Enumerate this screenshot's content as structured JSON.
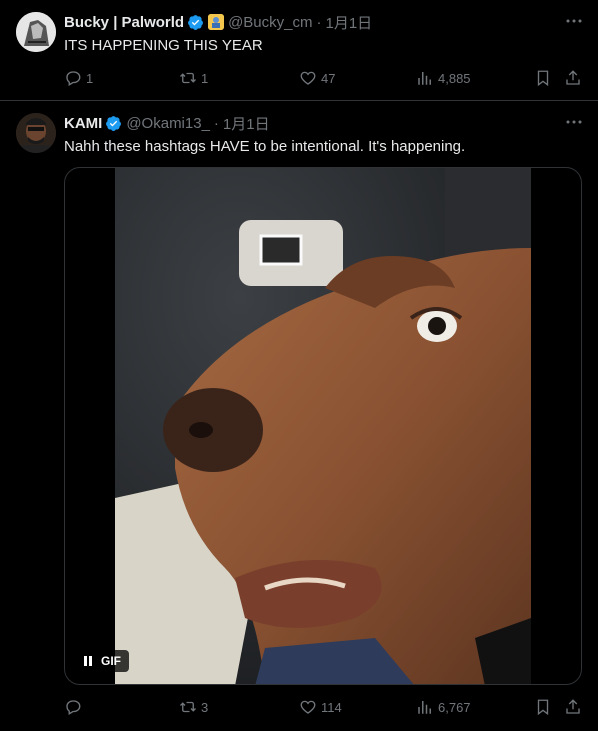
{
  "tweets": [
    {
      "name": "Bucky | Palworld",
      "handle": "@Bucky_cm",
      "time": "1月1日",
      "text": "ITS HAPPENING THIS YEAR",
      "replies": "1",
      "reposts": "1",
      "likes": "47",
      "views": "4,885"
    },
    {
      "name": "KAMI",
      "handle": "@Okami13_",
      "time": "1月1日",
      "text": "Nahh these hashtags HAVE to be intentional. It's happening.",
      "replies": "",
      "reposts": "3",
      "likes": "114",
      "views": "6,767",
      "media": {
        "badge": "GIF"
      }
    }
  ],
  "colors": {
    "accent": "#1d9bf0",
    "muted": "#71767b",
    "text": "#e7e9ea",
    "border": "#2f3336"
  },
  "icons": [
    "reply-icon",
    "repost-icon",
    "like-icon",
    "views-icon",
    "bookmark-icon",
    "share-icon",
    "more-icon",
    "verified-badge-icon",
    "pause-icon"
  ]
}
